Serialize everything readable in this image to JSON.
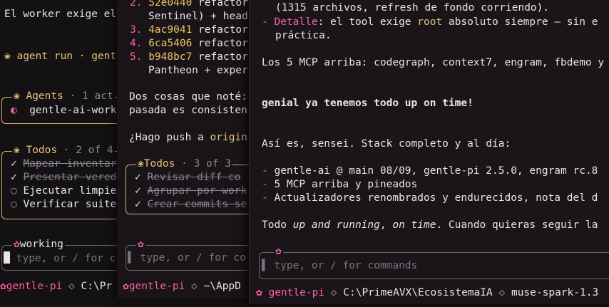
{
  "pane1": {
    "intro": "El worker exige el",
    "agent_run": "agent run · gent",
    "agents_title": "Agents",
    "agents_count": "· 1 act",
    "agent_item": "gentle-ai-work",
    "todos_title": "Todos",
    "todos_count": "· 2 of 4",
    "todos": [
      {
        "mark": "✓",
        "text": "Mapear inventar",
        "done": true
      },
      {
        "mark": "✓",
        "text": "Presentar vered",
        "done": true
      },
      {
        "mark": "○",
        "text": "Ejecutar limpie",
        "done": false
      },
      {
        "mark": "○",
        "text": "Verificar suite",
        "done": false
      }
    ],
    "input_label": "working",
    "placeholder": "type, or / for c",
    "status_app": "gentle-pi",
    "status_path": "C:\\Pr"
  },
  "pane2": {
    "commits": [
      {
        "num": "2.",
        "hash": "52e0440",
        "text": " refactor",
        "note": ""
      },
      {
        "num": "",
        "hash": "",
        "text": "Sentinel) + head",
        "note": ""
      },
      {
        "num": "3.",
        "hash": "4ac9041",
        "text": " refactor",
        "note": ""
      },
      {
        "num": "4.",
        "hash": "6ca5406",
        "text": " refactor",
        "note": ""
      },
      {
        "num": "5.",
        "hash": "b948bc7",
        "text": " refactor",
        "note": ""
      },
      {
        "num": "",
        "hash": "",
        "text": "Pantheon + exper",
        "note": ""
      }
    ],
    "para1": "Dos cosas que noté:",
    "para2": "pasada es consisten",
    "question_pre": "¿Hago push a ",
    "question_word": "origin",
    "todos_title": "Todos",
    "todos_count": "· 3 of 3",
    "todos": [
      {
        "mark": "✓",
        "text": "Revisar diff co"
      },
      {
        "mark": "✓",
        "text": "Agrupar por work"
      },
      {
        "mark": "✓",
        "text": "Crear commits se"
      }
    ],
    "placeholder": "type, or / for co",
    "status_app": "gentle-pi",
    "status_path": "~\\AppD"
  },
  "pane3": {
    "line_top": "(1315 archivos, refresh de fondo corriendo).",
    "detalle_dash": "-",
    "detalle_label": "Detalle",
    "detalle_text1": ": el tool exige ",
    "detalle_root": "root",
    "detalle_text2": " absoluto siempre — sin e",
    "detalle_cont": "práctica.",
    "mcp_line": "Los 5 MCP arriba: codegraph, context7, engram, fbdemo y",
    "user_msg": "genial ya tenemos todo up on time!",
    "reply": "Así es, sensei. Stack completo y al día:",
    "bullets": [
      "gentle-ai @ main 08/09, gentle-pi 2.5.0, engram rc.8",
      "5 MCP arriba y pineados",
      "Actualizadores renombrados y endurecidos, nota del d"
    ],
    "closing_pre": "Todo ",
    "closing_ital1": "up and running",
    "closing_mid": ", ",
    "closing_ital2": "on time",
    "closing_post": ". Cuando quieras seguir la",
    "placeholder": "type, or / for commands",
    "status_app": "gentle-pi",
    "status_path": "C:\\PrimeAVX\\EcosistemaIA",
    "status_model": "muse-spark-1.3"
  },
  "colors": {
    "accent_pink": "#ff5f9e",
    "accent_gold": "#e7c37a",
    "background": "#141114"
  },
  "icons": {
    "flower": "flower-icon",
    "diamond": "diamond-icon",
    "half_circle": "half-circle-icon"
  }
}
